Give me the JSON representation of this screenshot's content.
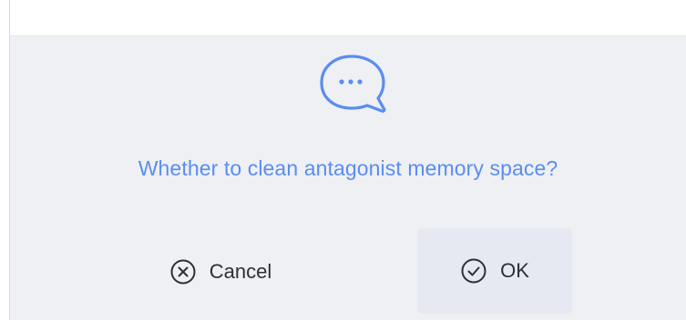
{
  "dialog": {
    "icon": "chat-bubble-ellipsis-icon",
    "message": "Whether to clean antagonist memory space?",
    "cancel_label": "Cancel",
    "ok_label": "OK",
    "cancel_icon": "circle-x-icon",
    "ok_icon": "circle-check-icon"
  },
  "colors": {
    "accent": "#5a8df2",
    "background": "#eef0f3",
    "ok_button_bg": "#e6e9f1",
    "text": "#2d2f33"
  }
}
